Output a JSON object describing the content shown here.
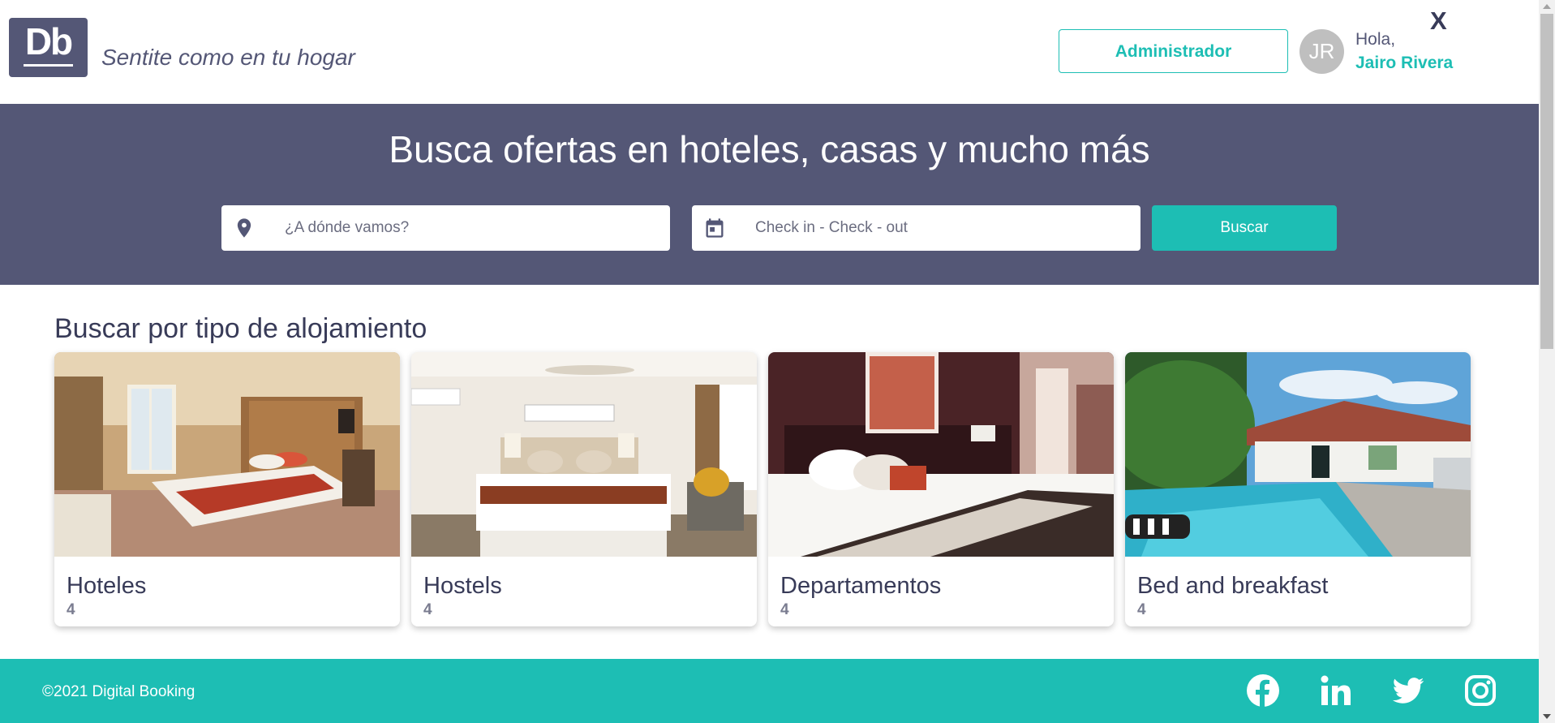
{
  "header": {
    "logo_text": "Db",
    "slogan": "Sentite como en tu hogar",
    "admin_button": "Administrador",
    "avatar_initials": "JR",
    "greeting": "Hola,",
    "user_name": "Jairo Rivera",
    "close_label": "X"
  },
  "search": {
    "title": "Busca ofertas en hoteles, casas y mucho más",
    "destination_placeholder": "¿A dónde vamos?",
    "date_placeholder": "Check in - Check - out",
    "button_label": "Buscar",
    "destination_icon": "location-pin-icon",
    "date_icon": "calendar-icon"
  },
  "categories": {
    "title": "Buscar por tipo de alojamiento",
    "items": [
      {
        "name": "Hoteles",
        "count": "4"
      },
      {
        "name": "Hostels",
        "count": "4"
      },
      {
        "name": "Departamentos",
        "count": "4"
      },
      {
        "name": "Bed and breakfast",
        "count": "4"
      }
    ]
  },
  "footer": {
    "copyright": "©2021 Digital Booking",
    "social_icons": [
      "facebook-icon",
      "linkedin-icon",
      "twitter-icon",
      "instagram-icon"
    ]
  },
  "colors": {
    "primary": "#545776",
    "accent": "#1dbeb4",
    "text_dark": "#383b58",
    "background": "#ffffff"
  }
}
